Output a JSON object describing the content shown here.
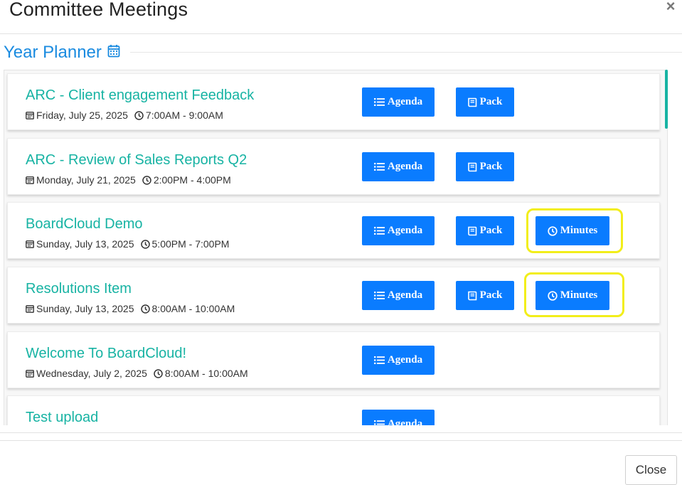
{
  "modal": {
    "title": "Committee Meetings",
    "close_icon": "×"
  },
  "section": {
    "title": "Year Planner",
    "icon": "calendar-icon"
  },
  "meetings": [
    {
      "title": "ARC - Client engagement Feedback",
      "date": "Friday, July 25, 2025",
      "time": "7:00AM - 9:00AM"
    },
    {
      "title": "ARC - Review of Sales Reports Q2",
      "date": "Monday, July 21, 2025",
      "time": "2:00PM - 4:00PM"
    },
    {
      "title": "BoardCloud Demo",
      "date": "Sunday, July 13, 2025",
      "time": "5:00PM - 7:00PM"
    },
    {
      "title": "Resolutions Item",
      "date": "Sunday, July 13, 2025",
      "time": "8:00AM - 10:00AM"
    },
    {
      "title": "Welcome To BoardCloud!",
      "date": "Wednesday, July 2, 2025",
      "time": "8:00AM - 10:00AM"
    },
    {
      "title": "Test upload"
    }
  ],
  "buttons": {
    "agenda": "Agenda",
    "pack": "Pack",
    "minutes": "Minutes"
  },
  "footer": {
    "close_label": "Close"
  },
  "colors": {
    "accent_teal": "#17b3a3",
    "button_blue": "#0a7cff",
    "title_blue": "#1a8be0",
    "highlight_yellow": "#f2ee1a"
  }
}
